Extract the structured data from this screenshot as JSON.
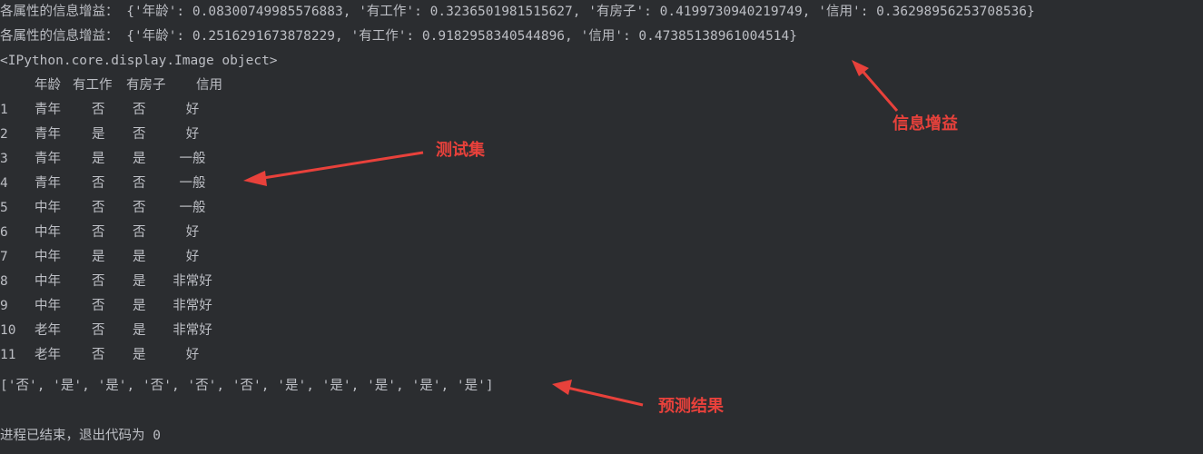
{
  "console": {
    "gain_line_1": "各属性的信息增益： {'年龄': 0.08300749985576883, '有工作': 0.3236501981515627, '有房子': 0.4199730940219749, '信用': 0.36298956253708536}",
    "gain_line_2": "各属性的信息增益： {'年龄': 0.2516291673878229, '有工作': 0.9182958340544896, '信用': 0.47385138961004514}",
    "image_line": "<IPython.core.display.Image object>",
    "table": {
      "headers": [
        "年龄",
        "有工作",
        "有房子",
        "信用"
      ],
      "rows": [
        [
          "1",
          "青年",
          "否",
          "否",
          "好"
        ],
        [
          "2",
          "青年",
          "是",
          "否",
          "好"
        ],
        [
          "3",
          "青年",
          "是",
          "是",
          "一般"
        ],
        [
          "4",
          "青年",
          "否",
          "否",
          "一般"
        ],
        [
          "5",
          "中年",
          "否",
          "否",
          "一般"
        ],
        [
          "6",
          "中年",
          "否",
          "否",
          "好"
        ],
        [
          "7",
          "中年",
          "是",
          "是",
          "好"
        ],
        [
          "8",
          "中年",
          "否",
          "是",
          "非常好"
        ],
        [
          "9",
          "中年",
          "否",
          "是",
          "非常好"
        ],
        [
          "10",
          "老年",
          "否",
          "是",
          "非常好"
        ],
        [
          "11",
          "老年",
          "否",
          "是",
          "好"
        ]
      ]
    },
    "predict_line": "['否', '是', '是', '否', '否', '否', '是', '是', '是', '是', '是']",
    "exit_line": "进程已结束，退出代码为 0"
  },
  "annotations": {
    "info_gain": "信息增益",
    "test_set": "测试集",
    "predict_result": "预测结果"
  },
  "colors": {
    "background": "#2b2d30",
    "text": "#bcbec4",
    "annotation": "#e8413b"
  }
}
